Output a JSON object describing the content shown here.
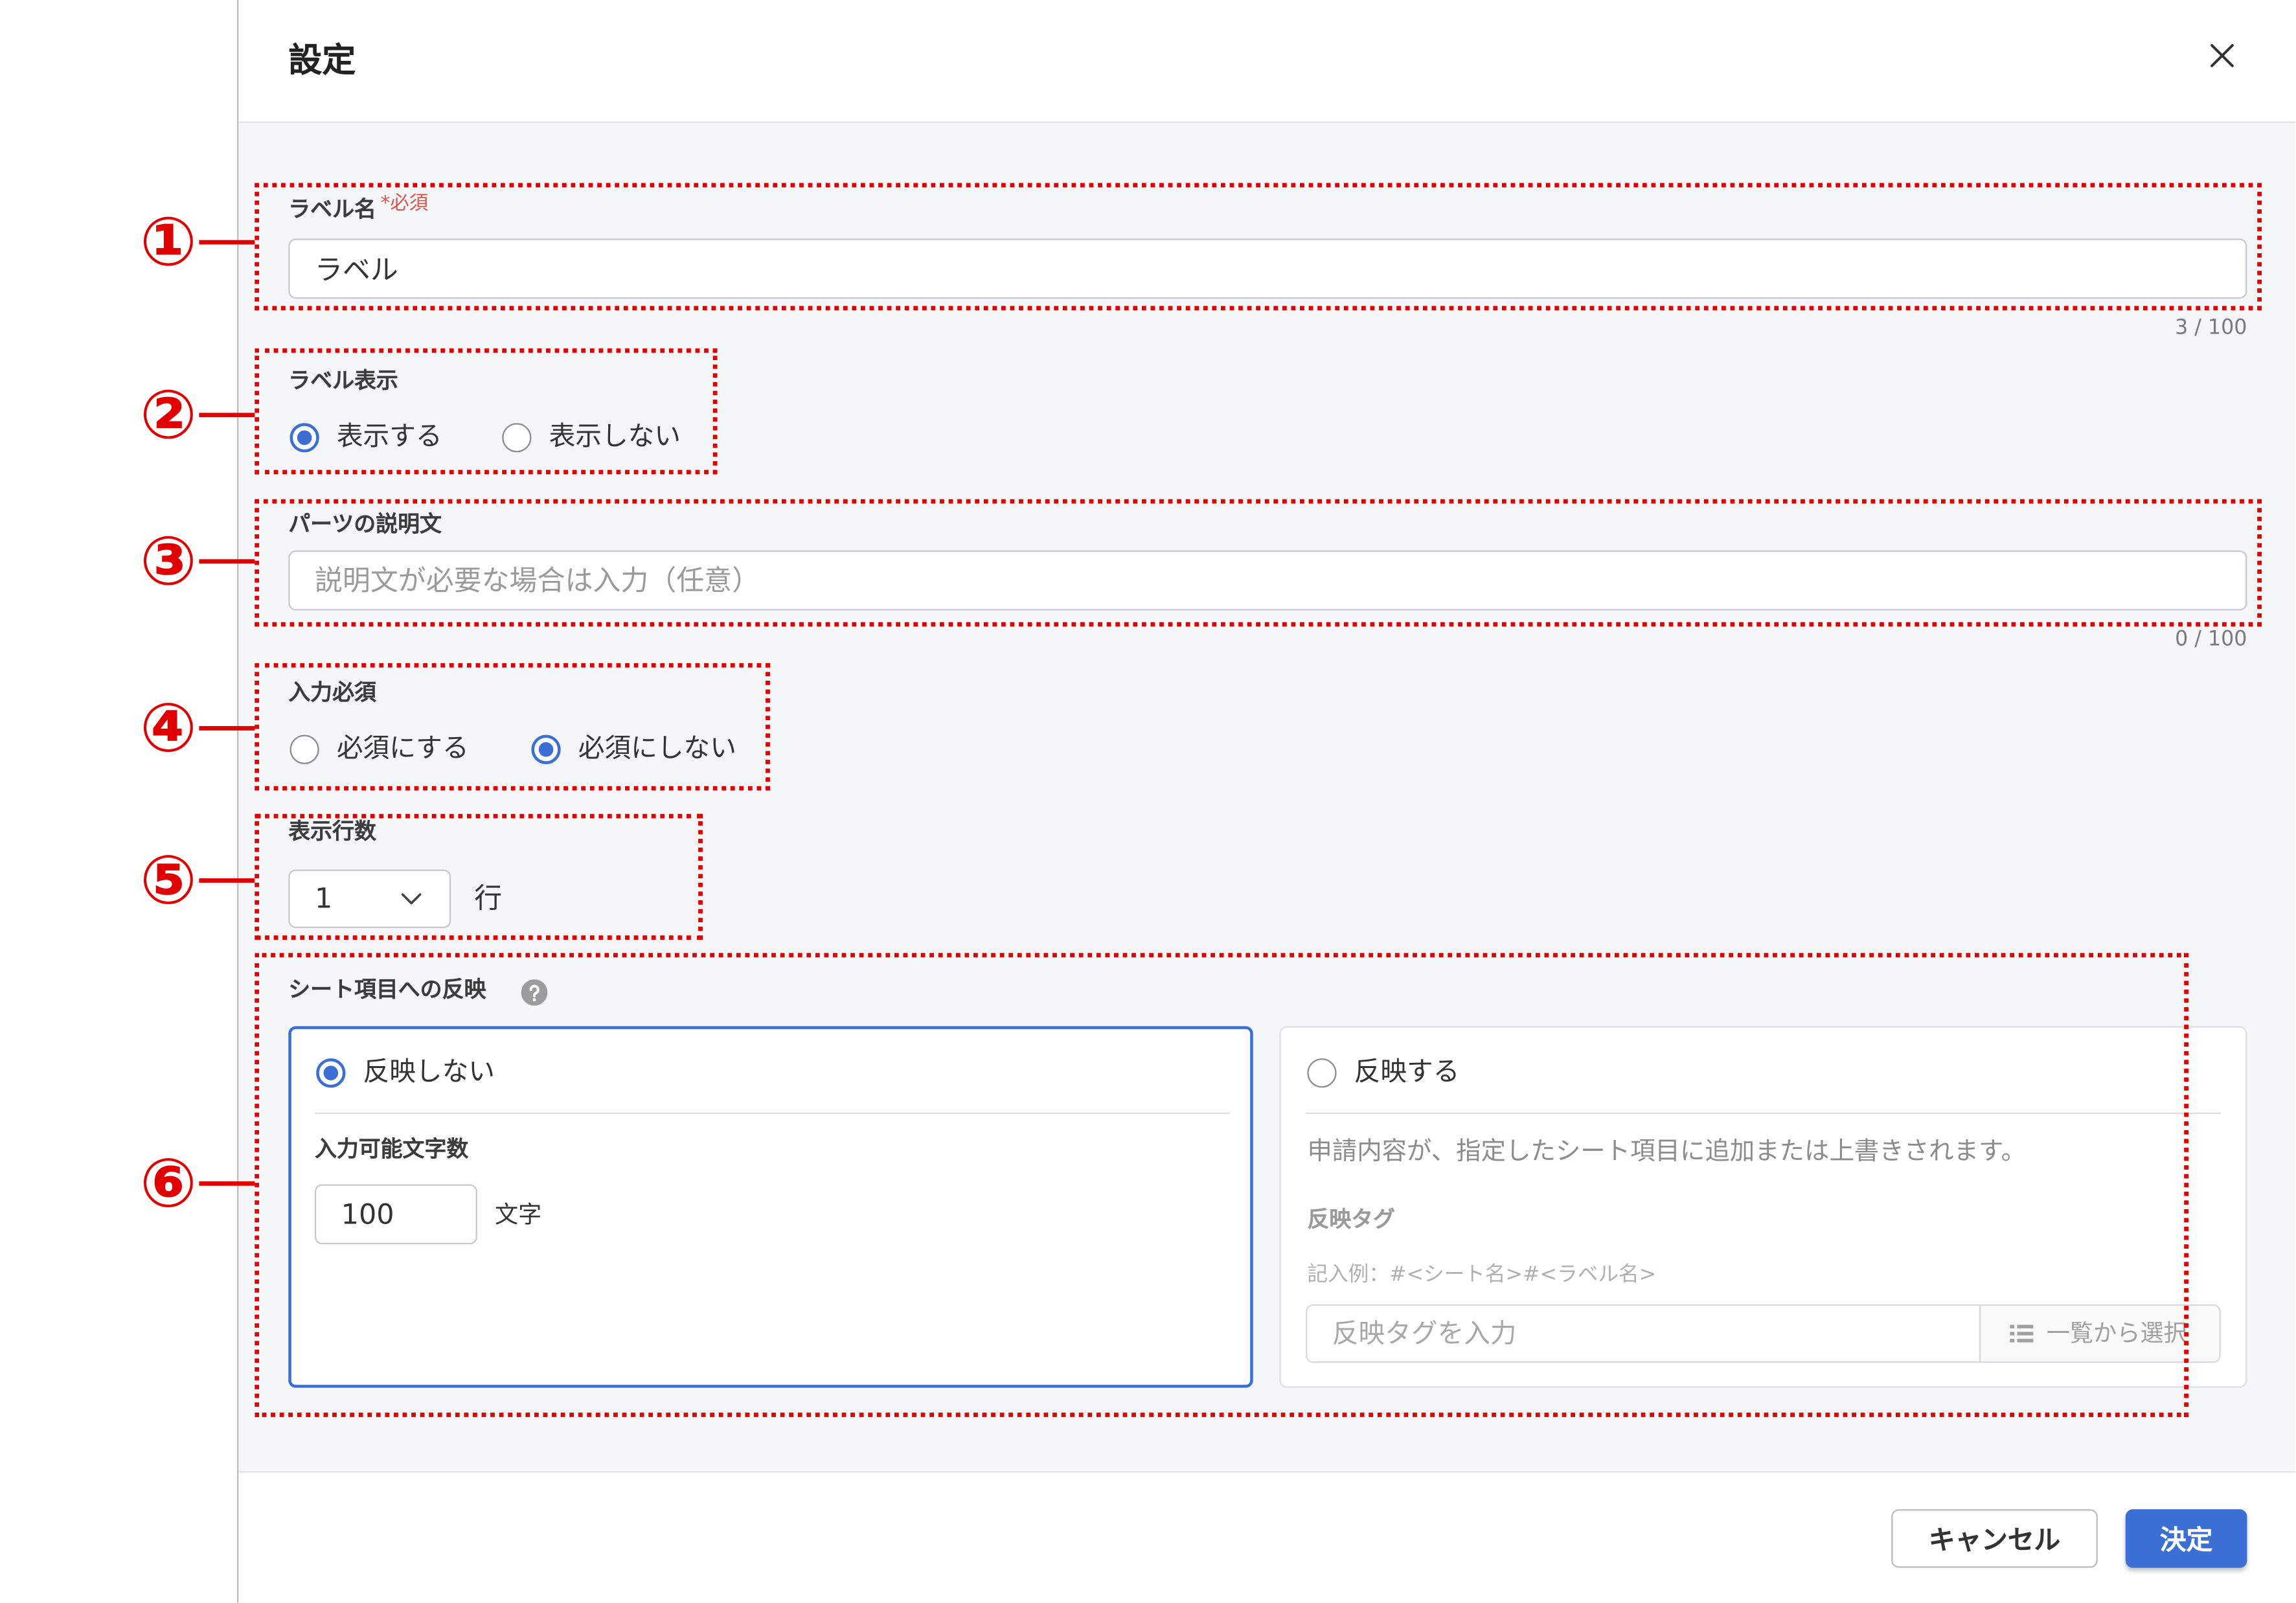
{
  "dialog": {
    "title": "設定"
  },
  "fields": {
    "label_name": {
      "label": "ラベル名",
      "required_mark": "*必須",
      "value": "ラベル",
      "counter": "3 / 100"
    },
    "label_display": {
      "label": "ラベル表示",
      "options": [
        {
          "label": "表示する",
          "checked": true
        },
        {
          "label": "表示しない",
          "checked": false
        }
      ]
    },
    "description": {
      "label": "パーツの説明文",
      "value": "",
      "placeholder": "説明文が必要な場合は入力（任意）",
      "counter": "0 / 100"
    },
    "required": {
      "label": "入力必須",
      "options": [
        {
          "label": "必須にする",
          "checked": false
        },
        {
          "label": "必須にしない",
          "checked": true
        }
      ]
    },
    "display_rows": {
      "label": "表示行数",
      "selected": "1",
      "unit": "行"
    },
    "sheet_reflection": {
      "label": "シート項目への反映",
      "options": [
        {
          "label": "反映しない",
          "checked": true,
          "max_chars_label": "入力可能文字数",
          "max_chars_value": "100",
          "max_chars_unit": "文字"
        },
        {
          "label": "反映する",
          "checked": false,
          "note": "申請内容が、指定したシート項目に追加または上書きされます。",
          "tag_label": "反映タグ",
          "tag_example": "記入例：#<シート名>#<ラベル名>",
          "tag_placeholder": "反映タグを入力",
          "list_button_label": "一覧から選択"
        }
      ]
    }
  },
  "footer": {
    "cancel_label": "キャンセル",
    "confirm_label": "決定"
  },
  "annotations": {
    "markers": [
      "①",
      "②",
      "③",
      "④",
      "⑤",
      "⑥"
    ]
  },
  "icons": {
    "close": "close-icon",
    "select_caret": "chevron-down-icon",
    "help": "help-icon",
    "list": "list-icon"
  },
  "colors": {
    "accent": "#3b6fd4",
    "annotation": "#e00000",
    "required": "#d9534f"
  }
}
